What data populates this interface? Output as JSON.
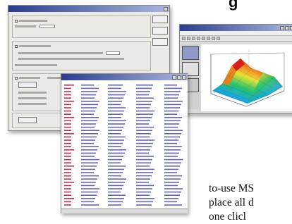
{
  "heading_fragment": "g",
  "paragraph_lines": [
    "to-use MS",
    "place all d",
    "one   clicl"
  ],
  "windows": {
    "options_dialog": {
      "title": ""
    },
    "chart_window": {
      "title": ""
    },
    "data_window": {
      "title": ""
    }
  },
  "chart_data": {
    "type": "surface",
    "title": "",
    "colormap": [
      "#1f2fb8",
      "#1aa7e0",
      "#27c46a",
      "#e8e23a",
      "#f07a1a",
      "#d6201e"
    ]
  },
  "colors": {
    "titlebar_start": "#2a3d8f",
    "titlebar_end": "#a9b7dd",
    "row_number_text": "#c0304a",
    "cell_text": "#4a4aa6"
  }
}
